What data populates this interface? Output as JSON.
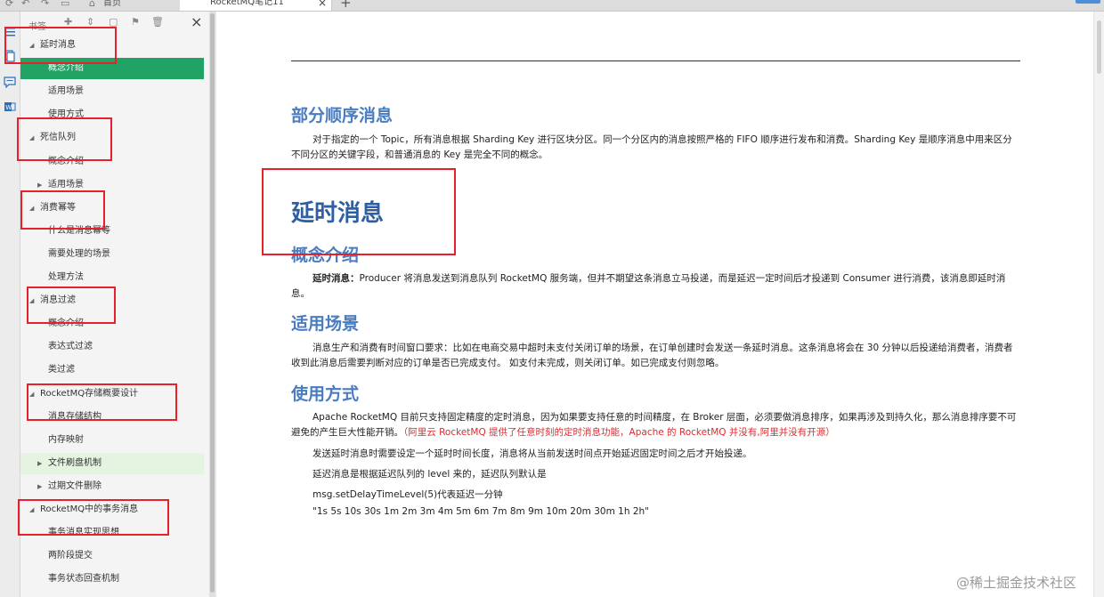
{
  "tabbar": {
    "home_label": "首页",
    "active_tab_title": "RocketMQ笔记11",
    "close_glyph": "×",
    "add_glyph": "+",
    "icons": [
      "app-menu-icon",
      "undo-icon",
      "redo-icon",
      "save-icon",
      "home-icon"
    ]
  },
  "rail": {
    "icons": [
      "outline-icon",
      "pages-icon",
      "comment-icon",
      "word-icon"
    ]
  },
  "bookmarks": {
    "title": "书签",
    "close_glyph": "×",
    "toolbar_icons": [
      "add-bookmark-icon",
      "expand-icon",
      "collapse-icon",
      "bookmark-icon",
      "delete-icon"
    ],
    "items": [
      {
        "label": "延时消息",
        "level": 1,
        "caret": "◢",
        "state": "normal"
      },
      {
        "label": "概念介绍",
        "level": 2,
        "caret": "",
        "state": "active"
      },
      {
        "label": "适用场景",
        "level": 2,
        "caret": "",
        "state": "normal"
      },
      {
        "label": "使用方式",
        "level": 2,
        "caret": "",
        "state": "normal"
      },
      {
        "label": "死信队列",
        "level": 1,
        "caret": "◢",
        "state": "normal"
      },
      {
        "label": "概念介绍",
        "level": 2,
        "caret": "",
        "state": "normal"
      },
      {
        "label": "适用场景",
        "level": 2,
        "caret": "▶",
        "state": "normal"
      },
      {
        "label": "消费幂等",
        "level": 1,
        "caret": "◢",
        "state": "normal"
      },
      {
        "label": "什么是消息幂等",
        "level": 2,
        "caret": "",
        "state": "normal"
      },
      {
        "label": "需要处理的场景",
        "level": 2,
        "caret": "",
        "state": "normal"
      },
      {
        "label": "处理方法",
        "level": 2,
        "caret": "",
        "state": "normal"
      },
      {
        "label": "消息过滤",
        "level": 1,
        "caret": "◢",
        "state": "normal"
      },
      {
        "label": "概念介绍",
        "level": 2,
        "caret": "",
        "state": "normal"
      },
      {
        "label": "表达式过滤",
        "level": 2,
        "caret": "",
        "state": "normal"
      },
      {
        "label": "类过滤",
        "level": 2,
        "caret": "",
        "state": "normal"
      },
      {
        "label": "RocketMQ存储概要设计",
        "level": 1,
        "caret": "◢",
        "state": "normal"
      },
      {
        "label": "消息存储结构",
        "level": 2,
        "caret": "",
        "state": "normal"
      },
      {
        "label": "内存映射",
        "level": 2,
        "caret": "",
        "state": "normal"
      },
      {
        "label": "文件刷盘机制",
        "level": 2,
        "caret": "▶",
        "state": "hover"
      },
      {
        "label": "过期文件删除",
        "level": 2,
        "caret": "▶",
        "state": "normal"
      },
      {
        "label": "RocketMQ中的事务消息",
        "level": 1,
        "caret": "◢",
        "state": "normal"
      },
      {
        "label": "事务消息实现思想",
        "level": 2,
        "caret": "",
        "state": "normal"
      },
      {
        "label": "两阶段提交",
        "level": 2,
        "caret": "",
        "state": "normal"
      },
      {
        "label": "事务状态回查机制",
        "level": 2,
        "caret": "",
        "state": "normal"
      }
    ]
  },
  "document": {
    "sec_partial_title": "部分顺序消息",
    "sec_partial_body": "对于指定的一个 Topic，所有消息根据 Sharding Key 进行区块分区。同一个分区内的消息按照严格的 FIFO 顺序进行发布和消费。Sharding Key 是顺序消息中用来区分不同分区的关键字段，和普通消息的 Key 是完全不同的概念。",
    "h1_delay": "延时消息",
    "sec_concept_title": "概念介绍",
    "concept_lead": "延时消息：",
    "concept_body": "Producer 将消息发送到消息队列 RocketMQ 服务端，但并不期望这条消息立马投递，而是延迟一定时间后才投递到 Consumer 进行消费，该消息即延时消息。",
    "sec_scene_title": "适用场景",
    "scene_body": "消息生产和消费有时间窗口要求：比如在电商交易中超时未支付关闭订单的场景，在订单创建时会发送一条延时消息。这条消息将会在 30 分钟以后投递给消费者，消费者收到此消息后需要判断对应的订单是否已完成支付。 如支付未完成，则关闭订单。如已完成支付则忽略。",
    "sec_usage_title": "使用方式",
    "usage_body": "Apache RocketMQ 目前只支持固定精度的定时消息，因为如果要支持任意的时间精度，在 Broker 层面，必须要做消息排序，如果再涉及到持久化，那么消息排序要不可避免的产生巨大性能开销。",
    "usage_note": "（阿里云 RocketMQ 提供了任意时刻的定时消息功能，Apache 的 RocketMQ 并没有,阿里并没有开源）",
    "usage_line1": "发送延时消息时需要设定一个延时时间长度，消息将从当前发送时间点开始延迟固定时间之后才开始投递。",
    "usage_line2": "延迟消息是根据延迟队列的 level 来的，延迟队列默认是",
    "usage_line3": "msg.setDelayTimeLevel(5)代表延迟一分钟",
    "usage_line4": "\"1s 5s 10s 30s 1m 2m 3m 4m 5m 6m 7m 8m 9m 10m 20m 30m 1h 2h\""
  },
  "watermark": "@稀土掘金技术社区",
  "colors": {
    "accent_green": "#21a366",
    "heading_blue": "#4a7cc0",
    "annotation_red": "#e8202a"
  }
}
